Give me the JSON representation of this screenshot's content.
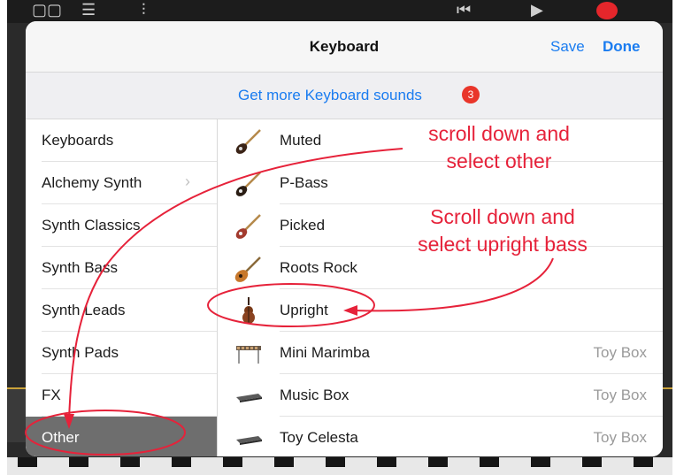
{
  "header": {
    "title": "Keyboard",
    "save_label": "Save",
    "done_label": "Done"
  },
  "banner": {
    "text": "Get more Keyboard sounds",
    "badge": "3"
  },
  "categories": [
    {
      "label": "Keyboards"
    },
    {
      "label": "Alchemy Synth",
      "chevron": "chevron-right-icon"
    },
    {
      "label": "Synth Classics"
    },
    {
      "label": "Synth Bass"
    },
    {
      "label": "Synth Leads"
    },
    {
      "label": "Synth Pads"
    },
    {
      "label": "FX"
    },
    {
      "label": "Other",
      "selected": true
    }
  ],
  "sounds": [
    {
      "name": "Muted",
      "tag": "",
      "icon": "electric-bass-icon"
    },
    {
      "name": "P-Bass",
      "tag": "",
      "icon": "electric-bass-icon"
    },
    {
      "name": "Picked",
      "tag": "",
      "icon": "electric-bass-icon"
    },
    {
      "name": "Roots Rock",
      "tag": "",
      "icon": "electric-guitar-icon"
    },
    {
      "name": "Upright",
      "tag": "",
      "icon": "upright-bass-icon"
    },
    {
      "name": "Mini Marimba",
      "tag": "Toy Box",
      "icon": "marimba-icon"
    },
    {
      "name": "Music Box",
      "tag": "Toy Box",
      "icon": "keyboard-icon"
    },
    {
      "name": "Toy Celesta",
      "tag": "Toy Box",
      "icon": "keyboard-icon"
    }
  ],
  "annotations": {
    "note1_line1": "scroll down and",
    "note1_line2": "select other",
    "note2_line1": "Scroll down and",
    "note2_line2": "select upright bass"
  },
  "colors": {
    "accent": "#1a7cf0",
    "badge": "#e9352a",
    "annotation": "#e6223a",
    "selected_row": "#6e6e6e"
  }
}
